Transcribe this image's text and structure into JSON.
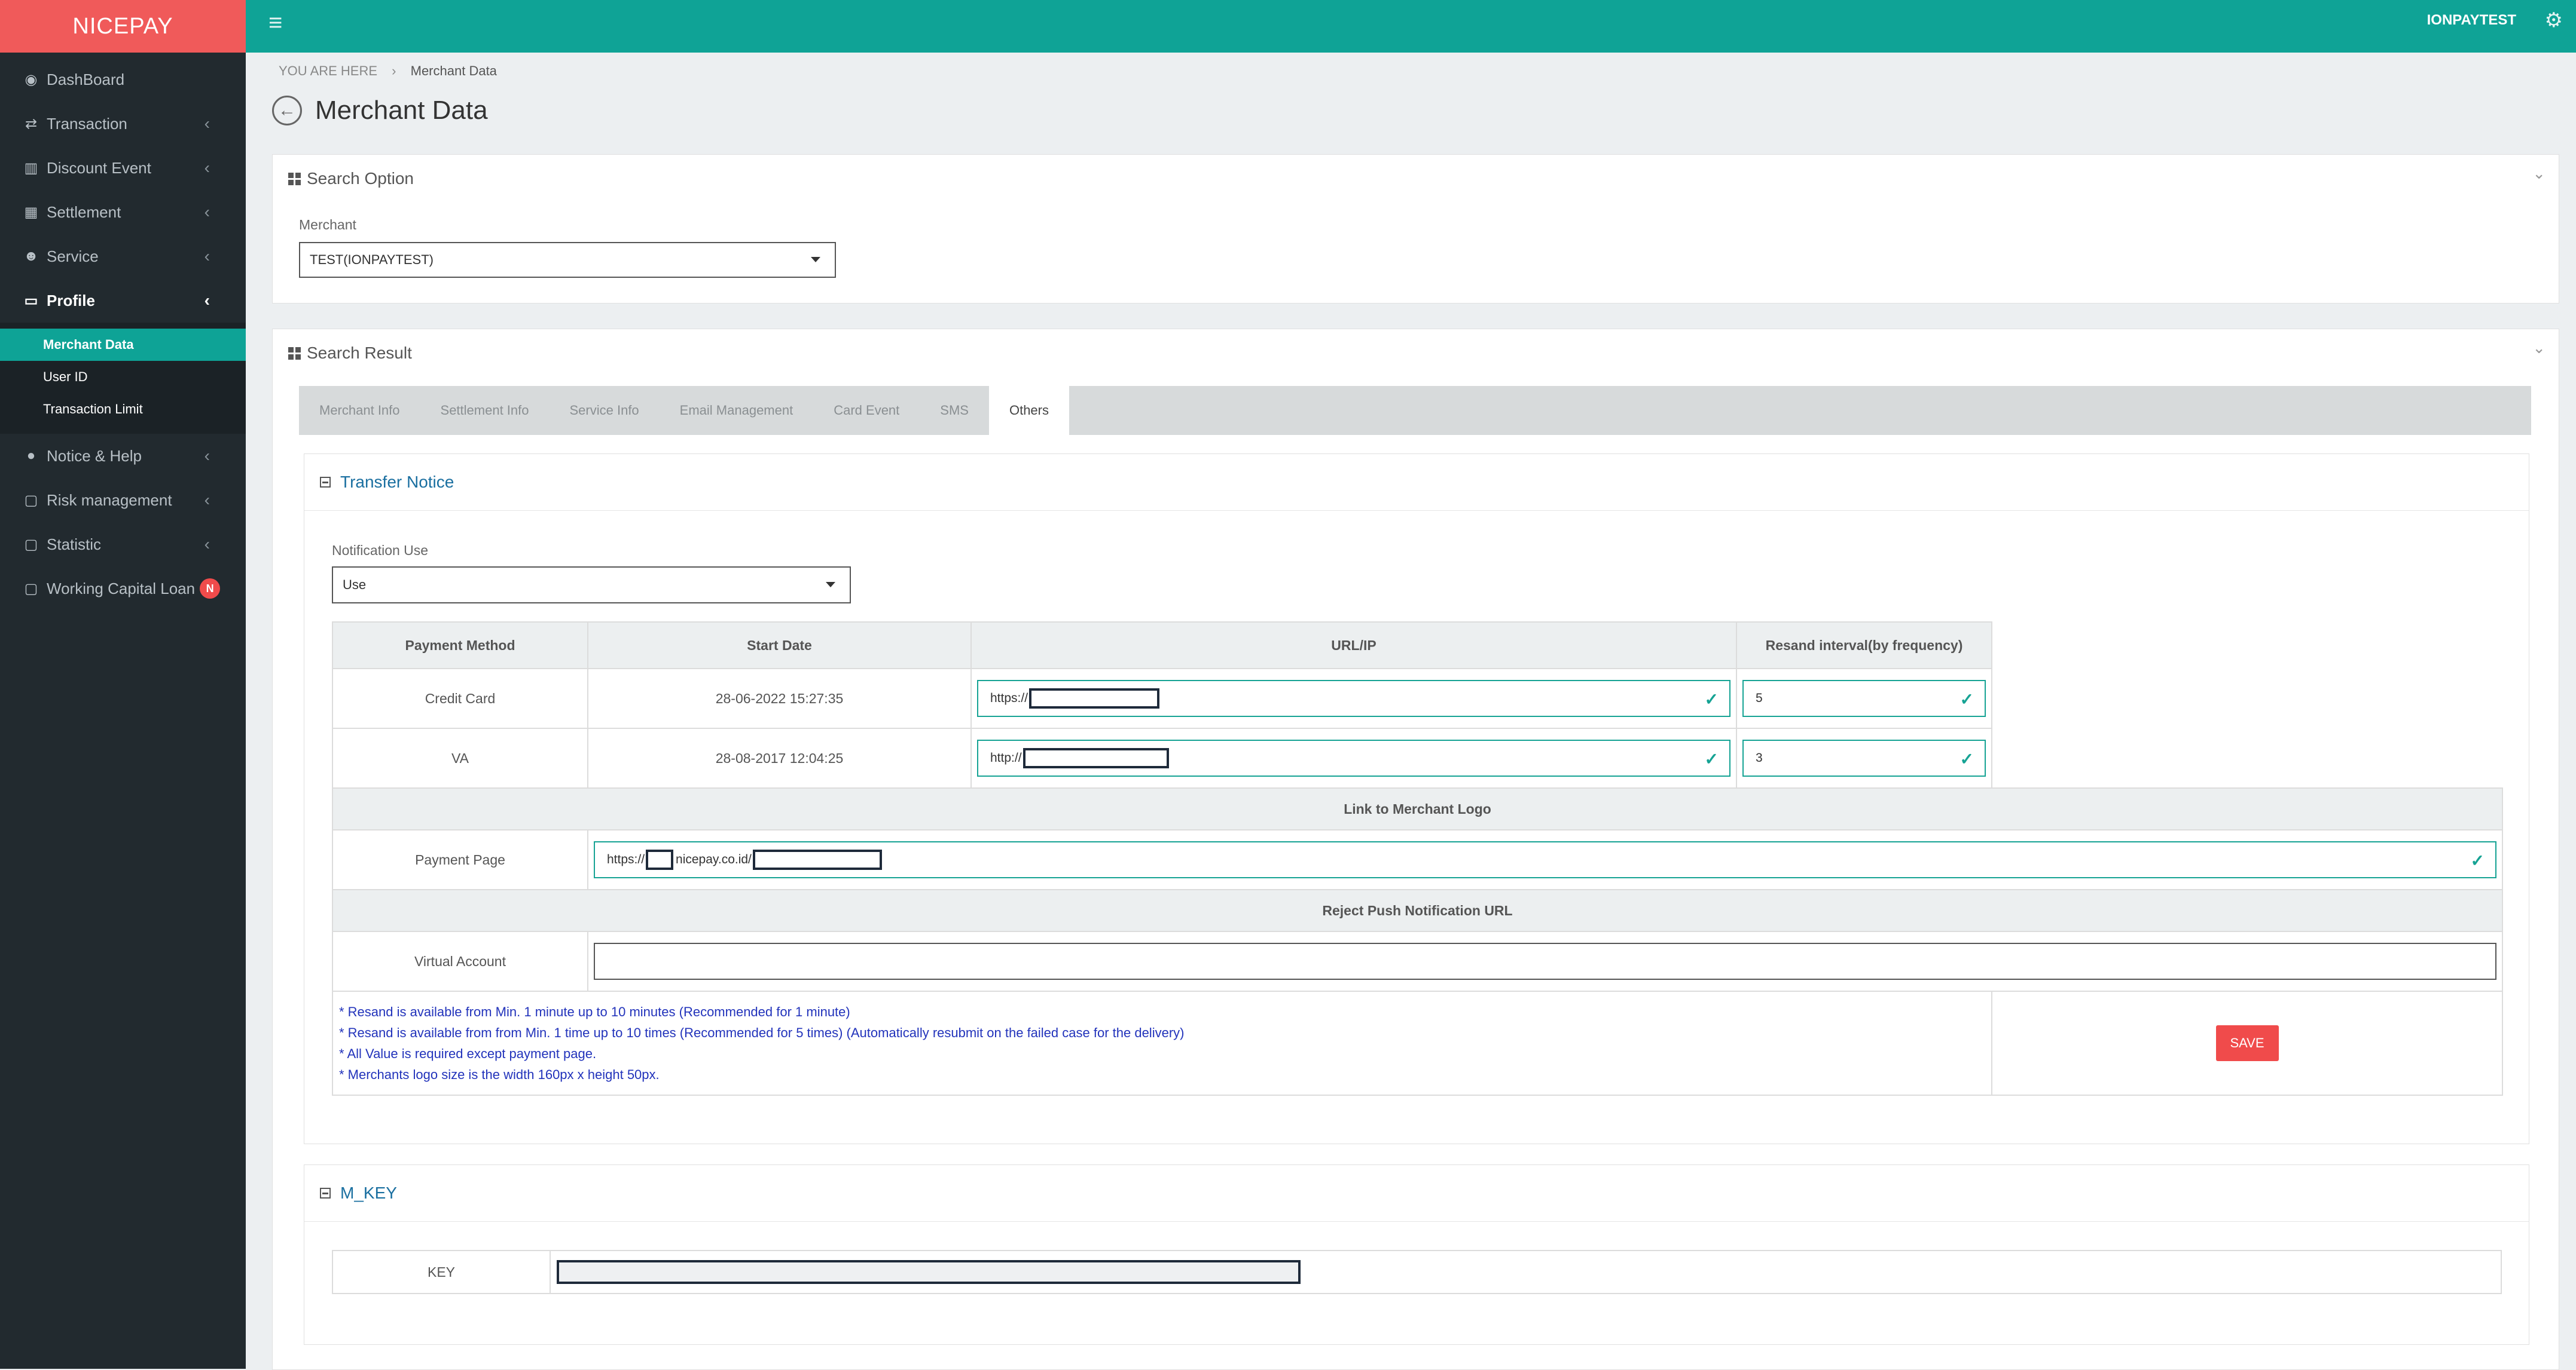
{
  "brand": "NICEPAY",
  "header": {
    "user": "IONPAYTEST"
  },
  "sidebar": {
    "items": [
      {
        "label": "DashBoard",
        "icon": "dashboard-icon"
      },
      {
        "label": "Transaction",
        "icon": "exchange-icon"
      },
      {
        "label": "Discount Event",
        "icon": "bar-chart-icon"
      },
      {
        "label": "Settlement",
        "icon": "calendar-icon"
      },
      {
        "label": "Service",
        "icon": "users-icon"
      },
      {
        "label": "Profile",
        "icon": "monitor-icon"
      }
    ],
    "profile_sub": [
      "Merchant Data",
      "User ID",
      "Transaction Limit"
    ],
    "items2": [
      {
        "label": "Notice & Help",
        "icon": "comment-icon"
      },
      {
        "label": "Risk management",
        "icon": "folder-icon"
      },
      {
        "label": "Statistic",
        "icon": "folder-icon"
      },
      {
        "label": "Working Capital Loan",
        "icon": "folder-icon",
        "badge": "N"
      }
    ]
  },
  "breadcrumb": {
    "prefix": "YOU ARE HERE",
    "separator": "›",
    "current": "Merchant Data"
  },
  "page_title": "Merchant Data",
  "search_option": {
    "title": "Search Option",
    "merchant_label": "Merchant",
    "merchant_value": "TEST(IONPAYTEST)"
  },
  "search_result": {
    "title": "Search Result",
    "tabs": [
      "Merchant Info",
      "Settlement Info",
      "Service Info",
      "Email Management",
      "Card Event",
      "SMS",
      "Others"
    ],
    "active_tab": "Others"
  },
  "transfer_notice": {
    "title": "Transfer Notice",
    "notification_label": "Notification Use",
    "notification_value": "Use",
    "headers": [
      "Payment Method",
      "Start Date",
      "URL/IP",
      "Resand interval(by frequency)"
    ],
    "rows": [
      {
        "method": "Credit Card",
        "start": "28-06-2022 15:27:35",
        "url_prefix": "https://",
        "interval": "5"
      },
      {
        "method": "VA",
        "start": "28-08-2017 12:04:25",
        "url_prefix": "http://",
        "interval": "3"
      }
    ],
    "logo_header": "Link to Merchant Logo",
    "payment_page_label": "Payment Page",
    "payment_page_prefix": "https://",
    "payment_page_domain": "nicepay.co.id/",
    "reject_header": "Reject Push Notification URL",
    "virtual_account_label": "Virtual Account",
    "virtual_account_value": "",
    "notes": [
      "* Resand is available from Min. 1 minute up to 10 minutes (Recommended for 1 minute)",
      "* Resand is available from from Min. 1 time up to 10 times (Recommended for 5 times) (Automatically resubmit on the failed case for the delivery)",
      "* All Value is required except payment page.",
      "* Merchants logo size is the width 160px x height 50px."
    ],
    "save_label": "SAVE"
  },
  "mkey": {
    "title": "M_KEY",
    "key_label": "KEY"
  },
  "colors": {
    "brand": "#f05a5a",
    "accent": "#0fa396",
    "sidebar": "#222a2f",
    "note": "#2233bb",
    "save": "#f04b4b"
  }
}
